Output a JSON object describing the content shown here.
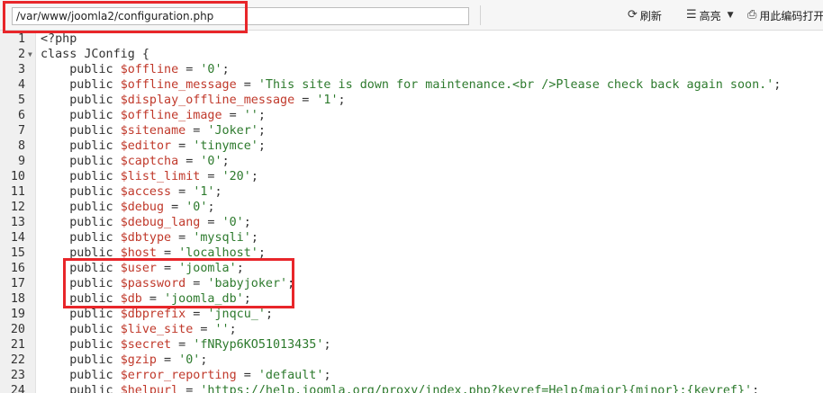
{
  "toolbar": {
    "path_value": "/var/www/joomla2/configuration.php",
    "refresh_label": "刷新",
    "highlight_label": "高亮",
    "encoding_label": "用此编码打开",
    "refresh_icon": "refresh-icon",
    "highlight_icon": "list-icon",
    "encoding_icon": "open-encoding-icon"
  },
  "editor": {
    "lines": [
      {
        "num": "1",
        "tokens": [
          {
            "t": "<?php",
            "c": "php"
          }
        ]
      },
      {
        "num": "2",
        "fold": true,
        "tokens": [
          {
            "t": "class JConfig {",
            "c": "kw"
          }
        ]
      },
      {
        "num": "3",
        "tokens": [
          {
            "t": "    public ",
            "c": "public"
          },
          {
            "t": "$offline",
            "c": "var"
          },
          {
            "t": " = ",
            "c": "op"
          },
          {
            "t": "'0'",
            "c": "str"
          },
          {
            "t": ";",
            "c": "punct"
          }
        ]
      },
      {
        "num": "4",
        "tokens": [
          {
            "t": "    public ",
            "c": "public"
          },
          {
            "t": "$offline_message",
            "c": "var"
          },
          {
            "t": " = ",
            "c": "op"
          },
          {
            "t": "'This site is down for maintenance.<br />Please check back again soon.'",
            "c": "str"
          },
          {
            "t": ";",
            "c": "punct"
          }
        ]
      },
      {
        "num": "5",
        "tokens": [
          {
            "t": "    public ",
            "c": "public"
          },
          {
            "t": "$display_offline_message",
            "c": "var"
          },
          {
            "t": " = ",
            "c": "op"
          },
          {
            "t": "'1'",
            "c": "str"
          },
          {
            "t": ";",
            "c": "punct"
          }
        ]
      },
      {
        "num": "6",
        "tokens": [
          {
            "t": "    public ",
            "c": "public"
          },
          {
            "t": "$offline_image",
            "c": "var"
          },
          {
            "t": " = ",
            "c": "op"
          },
          {
            "t": "''",
            "c": "str"
          },
          {
            "t": ";",
            "c": "punct"
          }
        ]
      },
      {
        "num": "7",
        "tokens": [
          {
            "t": "    public ",
            "c": "public"
          },
          {
            "t": "$sitename",
            "c": "var"
          },
          {
            "t": " = ",
            "c": "op"
          },
          {
            "t": "'Joker'",
            "c": "str"
          },
          {
            "t": ";",
            "c": "punct"
          }
        ]
      },
      {
        "num": "8",
        "tokens": [
          {
            "t": "    public ",
            "c": "public"
          },
          {
            "t": "$editor",
            "c": "var"
          },
          {
            "t": " = ",
            "c": "op"
          },
          {
            "t": "'tinymce'",
            "c": "str"
          },
          {
            "t": ";",
            "c": "punct"
          }
        ]
      },
      {
        "num": "9",
        "tokens": [
          {
            "t": "    public ",
            "c": "public"
          },
          {
            "t": "$captcha",
            "c": "var"
          },
          {
            "t": " = ",
            "c": "op"
          },
          {
            "t": "'0'",
            "c": "str"
          },
          {
            "t": ";",
            "c": "punct"
          }
        ]
      },
      {
        "num": "10",
        "tokens": [
          {
            "t": "    public ",
            "c": "public"
          },
          {
            "t": "$list_limit",
            "c": "var"
          },
          {
            "t": " = ",
            "c": "op"
          },
          {
            "t": "'20'",
            "c": "str"
          },
          {
            "t": ";",
            "c": "punct"
          }
        ]
      },
      {
        "num": "11",
        "tokens": [
          {
            "t": "    public ",
            "c": "public"
          },
          {
            "t": "$access",
            "c": "var"
          },
          {
            "t": " = ",
            "c": "op"
          },
          {
            "t": "'1'",
            "c": "str"
          },
          {
            "t": ";",
            "c": "punct"
          }
        ]
      },
      {
        "num": "12",
        "tokens": [
          {
            "t": "    public ",
            "c": "public"
          },
          {
            "t": "$debug",
            "c": "var"
          },
          {
            "t": " = ",
            "c": "op"
          },
          {
            "t": "'0'",
            "c": "str"
          },
          {
            "t": ";",
            "c": "punct"
          }
        ]
      },
      {
        "num": "13",
        "tokens": [
          {
            "t": "    public ",
            "c": "public"
          },
          {
            "t": "$debug_lang",
            "c": "var"
          },
          {
            "t": " = ",
            "c": "op"
          },
          {
            "t": "'0'",
            "c": "str"
          },
          {
            "t": ";",
            "c": "punct"
          }
        ]
      },
      {
        "num": "14",
        "tokens": [
          {
            "t": "    public ",
            "c": "public"
          },
          {
            "t": "$dbtype",
            "c": "var"
          },
          {
            "t": " = ",
            "c": "op"
          },
          {
            "t": "'mysqli'",
            "c": "str"
          },
          {
            "t": ";",
            "c": "punct"
          }
        ]
      },
      {
        "num": "15",
        "tokens": [
          {
            "t": "    public ",
            "c": "public"
          },
          {
            "t": "$host",
            "c": "var"
          },
          {
            "t": " = ",
            "c": "op"
          },
          {
            "t": "'localhost'",
            "c": "str"
          },
          {
            "t": ";",
            "c": "punct"
          }
        ]
      },
      {
        "num": "16",
        "tokens": [
          {
            "t": "    public ",
            "c": "public"
          },
          {
            "t": "$user",
            "c": "var"
          },
          {
            "t": " = ",
            "c": "op"
          },
          {
            "t": "'joomla'",
            "c": "str"
          },
          {
            "t": ";",
            "c": "punct"
          }
        ]
      },
      {
        "num": "17",
        "tokens": [
          {
            "t": "    public ",
            "c": "public"
          },
          {
            "t": "$password",
            "c": "var"
          },
          {
            "t": " = ",
            "c": "op"
          },
          {
            "t": "'babyjoker'",
            "c": "str"
          },
          {
            "t": ";",
            "c": "punct"
          }
        ]
      },
      {
        "num": "18",
        "tokens": [
          {
            "t": "    public ",
            "c": "public"
          },
          {
            "t": "$db",
            "c": "var"
          },
          {
            "t": " = ",
            "c": "op"
          },
          {
            "t": "'joomla_db'",
            "c": "str"
          },
          {
            "t": ";",
            "c": "punct"
          }
        ]
      },
      {
        "num": "19",
        "tokens": [
          {
            "t": "    public ",
            "c": "public"
          },
          {
            "t": "$dbprefix",
            "c": "var"
          },
          {
            "t": " = ",
            "c": "op"
          },
          {
            "t": "'jnqcu_'",
            "c": "str"
          },
          {
            "t": ";",
            "c": "punct"
          }
        ]
      },
      {
        "num": "20",
        "tokens": [
          {
            "t": "    public ",
            "c": "public"
          },
          {
            "t": "$live_site",
            "c": "var"
          },
          {
            "t": " = ",
            "c": "op"
          },
          {
            "t": "''",
            "c": "str"
          },
          {
            "t": ";",
            "c": "punct"
          }
        ]
      },
      {
        "num": "21",
        "tokens": [
          {
            "t": "    public ",
            "c": "public"
          },
          {
            "t": "$secret",
            "c": "var"
          },
          {
            "t": " = ",
            "c": "op"
          },
          {
            "t": "'fNRyp6KO51013435'",
            "c": "str"
          },
          {
            "t": ";",
            "c": "punct"
          }
        ]
      },
      {
        "num": "22",
        "tokens": [
          {
            "t": "    public ",
            "c": "public"
          },
          {
            "t": "$gzip",
            "c": "var"
          },
          {
            "t": " = ",
            "c": "op"
          },
          {
            "t": "'0'",
            "c": "str"
          },
          {
            "t": ";",
            "c": "punct"
          }
        ]
      },
      {
        "num": "23",
        "tokens": [
          {
            "t": "    public ",
            "c": "public"
          },
          {
            "t": "$error_reporting",
            "c": "var"
          },
          {
            "t": " = ",
            "c": "op"
          },
          {
            "t": "'default'",
            "c": "str"
          },
          {
            "t": ";",
            "c": "punct"
          }
        ]
      },
      {
        "num": "24",
        "tokens": [
          {
            "t": "    public ",
            "c": "public"
          },
          {
            "t": "$helpurl",
            "c": "var"
          },
          {
            "t": " = ",
            "c": "op"
          },
          {
            "t": "'https://help.joomla.org/proxy/index.php?keyref=Help{major}{minor}:{keyref}'",
            "c": "str"
          },
          {
            "t": ";",
            "c": "punct"
          }
        ]
      }
    ]
  },
  "colors": {
    "annotation_red": "#e8262a",
    "variable": "#c0392b",
    "string": "#2d7a2d",
    "text": "#333333"
  }
}
